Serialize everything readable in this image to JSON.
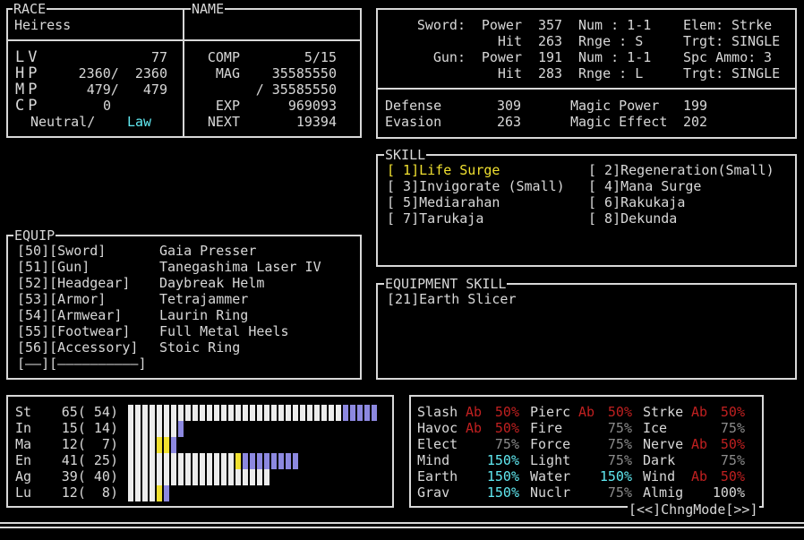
{
  "header": {
    "race_title": "RACE",
    "race": "Heiress",
    "name_title": "NAME",
    "name": "",
    "stats": [
      {
        "label": "LV",
        "value": "77"
      },
      {
        "label": "HP",
        "value": "2360/  2360"
      },
      {
        "label": "MP",
        "value": "479/   479"
      },
      {
        "label": "CP",
        "value": "0"
      }
    ],
    "alignment": "Neutral/",
    "alignment_law": "Law",
    "right": [
      {
        "label": "COMP",
        "value": "5/15"
      },
      {
        "label": "MAG",
        "value": "35585550"
      },
      {
        "label": "",
        "value": "/ 35585550"
      },
      {
        "label": "EXP",
        "value": "969093"
      },
      {
        "label": "NEXT",
        "value": "19394"
      }
    ]
  },
  "weapons": {
    "rows": [
      {
        "c1": "Sword:",
        "c2": "Power",
        "c3": "357",
        "c4": "Num : 1-1",
        "c5": "Elem:",
        "c6": "Strke"
      },
      {
        "c1": "",
        "c2": "Hit",
        "c3": "263",
        "c4": "Rnge : S",
        "c5": "Trgt:",
        "c6": "SINGLE"
      },
      {
        "c1": "Gun:",
        "c2": "Power",
        "c3": "191",
        "c4": "Num : 1-1",
        "c5": "Spc Ammo:",
        "c6": "3"
      },
      {
        "c1": "",
        "c2": "Hit",
        "c3": "283",
        "c4": "Rnge : L",
        "c5": "Trgt:",
        "c6": "SINGLE"
      }
    ],
    "defense_label": "Defense",
    "defense": "309",
    "evasion_label": "Evasion",
    "evasion": "263",
    "mpower_label": "Magic Power",
    "mpower": "199",
    "meffect_label": "Magic Effect",
    "meffect": "202"
  },
  "skill": {
    "title": "SKILL",
    "items": [
      {
        "text": "[ 1]Life Surge"
      },
      {
        "text": "[ 2]Regeneration(Small)"
      },
      {
        "text": "[ 3]Invigorate (Small)"
      },
      {
        "text": "[ 4]Mana Surge"
      },
      {
        "text": "[ 5]Mediarahan"
      },
      {
        "text": "[ 6]Rakukaja"
      },
      {
        "text": "[ 7]Tarukaja"
      },
      {
        "text": "[ 8]Dekunda"
      }
    ]
  },
  "equip": {
    "title": "EQUIP",
    "rows": [
      {
        "slot": "[50][Sword]",
        "item": "Gaia Presser"
      },
      {
        "slot": "[51][Gun]",
        "item": "Tanegashima Laser IV"
      },
      {
        "slot": "[52][Headgear]",
        "item": "Daybreak Helm"
      },
      {
        "slot": "[53][Armor]",
        "item": "Tetrajammer"
      },
      {
        "slot": "[54][Armwear]",
        "item": "Laurin Ring"
      },
      {
        "slot": "[55][Footwear]",
        "item": "Full Metal Heels"
      },
      {
        "slot": "[56][Accessory]",
        "item": "Stoic Ring"
      },
      {
        "slot": "[——][——————————]",
        "item": ""
      }
    ]
  },
  "equipment_skill": {
    "title": "EQUIPMENT SKILL",
    "items": [
      "[21]Earth Slicer"
    ]
  },
  "attributes": [
    {
      "label": "St",
      "value": "65( 54)",
      "white": 30,
      "yellow": 0,
      "blue": 5
    },
    {
      "label": "In",
      "value": "15( 14)",
      "white": 7,
      "yellow": 0,
      "blue": 1
    },
    {
      "label": "Ma",
      "value": "12(  7)",
      "white": 4,
      "yellow": 2,
      "blue": 1
    },
    {
      "label": "En",
      "value": "41( 25)",
      "white": 15,
      "yellow": 1,
      "blue": 8
    },
    {
      "label": "Ag",
      "value": "39( 40)",
      "white": 20,
      "yellow": 0,
      "blue": 0
    },
    {
      "label": "Lu",
      "value": "12(  8)",
      "white": 4,
      "yellow": 1,
      "blue": 1
    }
  ],
  "colors": {
    "yellow": "#f0e030",
    "blue": "#8c88e0",
    "white": "#ececec",
    "cyan": "#60e8f0",
    "red": "#c02020",
    "gray": "#8c8c8c"
  },
  "resistances": {
    "rows": [
      [
        {
          "n": "Slash",
          "p": "Ab",
          "v": "50%",
          "t": "ab"
        },
        {
          "n": "Pierc",
          "p": "Ab",
          "v": "50%",
          "t": "ab"
        },
        {
          "n": "Strke",
          "p": "Ab",
          "v": "50%",
          "t": "ab"
        }
      ],
      [
        {
          "n": "Havoc",
          "p": "Ab",
          "v": "50%",
          "t": "ab"
        },
        {
          "n": "Fire",
          "p": "",
          "v": "75%",
          "t": "dim"
        },
        {
          "n": "Ice",
          "p": "",
          "v": "75%",
          "t": "dim"
        }
      ],
      [
        {
          "n": "Elect",
          "p": "",
          "v": "75%",
          "t": "dim"
        },
        {
          "n": "Force",
          "p": "",
          "v": "75%",
          "t": "dim"
        },
        {
          "n": "Nerve",
          "p": "Ab",
          "v": "50%",
          "t": "ab"
        }
      ],
      [
        {
          "n": "Mind",
          "p": "",
          "v": "150%",
          "t": "cy"
        },
        {
          "n": "Light",
          "p": "",
          "v": "75%",
          "t": "dim"
        },
        {
          "n": "Dark",
          "p": "",
          "v": "75%",
          "t": "dim"
        }
      ],
      [
        {
          "n": "Earth",
          "p": "",
          "v": "150%",
          "t": "cy"
        },
        {
          "n": "Water",
          "p": "",
          "v": "150%",
          "t": "cy"
        },
        {
          "n": "Wind",
          "p": "Ab",
          "v": "50%",
          "t": "ab"
        }
      ],
      [
        {
          "n": "Grav",
          "p": "",
          "v": "150%",
          "t": "cy"
        },
        {
          "n": "Nuclr",
          "p": "",
          "v": "75%",
          "t": "dim"
        },
        {
          "n": "Almig",
          "p": "",
          "v": "100%",
          "t": "norm"
        }
      ]
    ],
    "mode_label": "[<<]ChngMode[>>]"
  }
}
